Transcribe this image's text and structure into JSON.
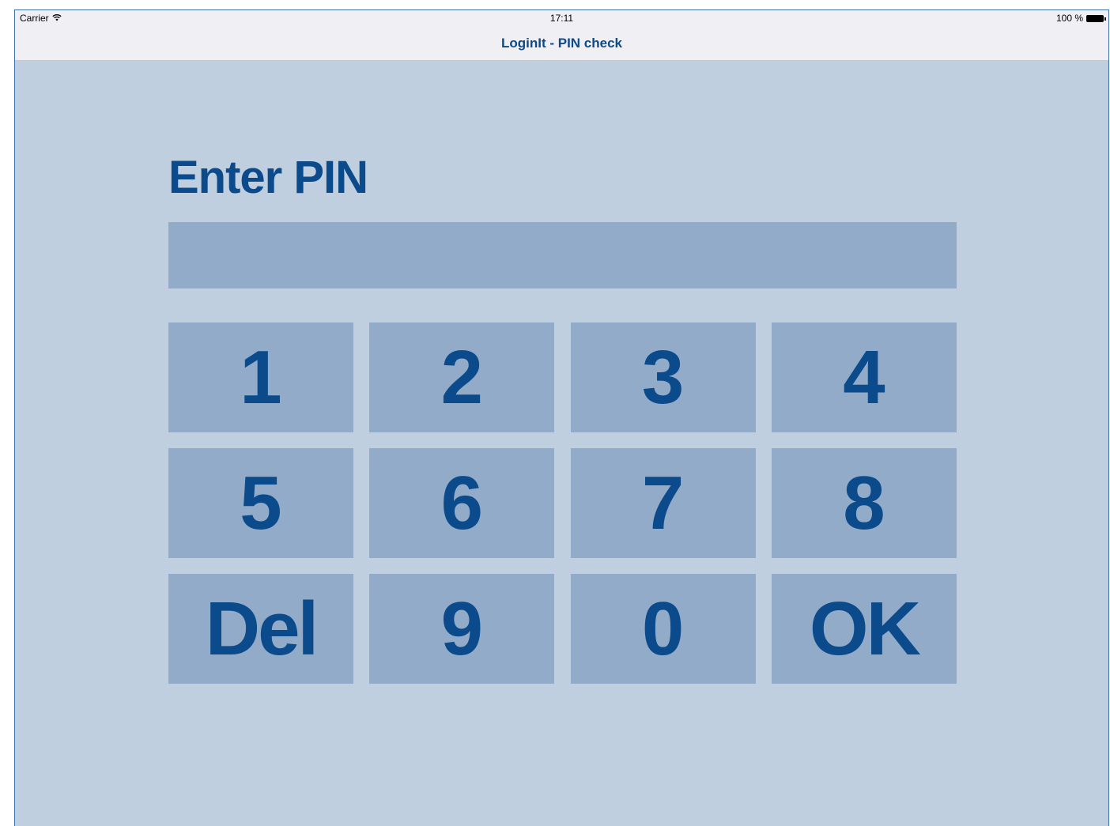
{
  "status_bar": {
    "carrier": "Carrier",
    "wifi_icon": "wifi-icon",
    "time": "17:11",
    "battery_text": "100 %",
    "battery_icon": "battery-icon"
  },
  "nav_bar": {
    "title": "LoginIt - PIN check"
  },
  "main": {
    "heading": "Enter PIN",
    "pin_value": "",
    "pin_placeholder": ""
  },
  "keypad": {
    "keys": [
      "1",
      "2",
      "3",
      "4",
      "5",
      "6",
      "7",
      "8",
      "Del",
      "9",
      "0",
      "OK"
    ]
  },
  "colors": {
    "background": "#bfcfe0",
    "key_background": "#91abc8",
    "accent": "#0b4a8b",
    "bar_background": "#efeff4"
  }
}
